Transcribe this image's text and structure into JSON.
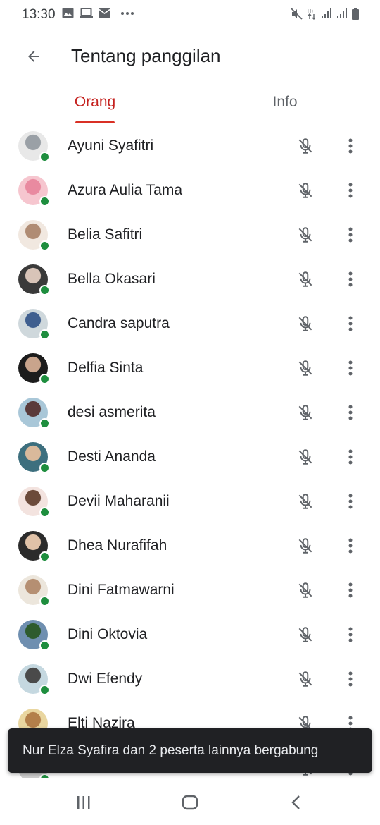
{
  "status_bar": {
    "time": "13:30",
    "left_icons": [
      "image-icon",
      "laptop-icon",
      "mail-icon",
      "more-dots-icon"
    ],
    "right_icons": [
      "mute-icon",
      "data-arrows-icon",
      "signal-icon",
      "signal-icon",
      "battery-icon"
    ],
    "network_label": "H+"
  },
  "app_bar": {
    "title": "Tentang panggilan",
    "back_icon": "arrow-back-icon"
  },
  "tabs": [
    {
      "label": "Orang",
      "selected": true
    },
    {
      "label": "Info",
      "selected": false
    }
  ],
  "participants": [
    {
      "name": "Ayuni Syafitri",
      "online": true,
      "muted": true,
      "avatar_colors": [
        "#e8e8e8",
        "#9aa0a6"
      ]
    },
    {
      "name": "Azura Aulia Tama",
      "online": true,
      "muted": true,
      "avatar_colors": [
        "#f6c6cf",
        "#e98aa0"
      ]
    },
    {
      "name": "Belia Safitri",
      "online": true,
      "muted": true,
      "avatar_colors": [
        "#f1e8e0",
        "#b08c74"
      ]
    },
    {
      "name": "Bella Okasari",
      "online": true,
      "muted": true,
      "avatar_colors": [
        "#3a3a3a",
        "#d8c4b8"
      ]
    },
    {
      "name": "Candra saputra",
      "online": true,
      "muted": true,
      "avatar_colors": [
        "#cfd8dc",
        "#3f5f8f"
      ]
    },
    {
      "name": "Delfia Sinta",
      "online": true,
      "muted": true,
      "avatar_colors": [
        "#1c1c1c",
        "#c9a48c"
      ]
    },
    {
      "name": "desi asmerita",
      "online": true,
      "muted": true,
      "avatar_colors": [
        "#a9c7d8",
        "#5a3a3a"
      ]
    },
    {
      "name": "Desti Ananda",
      "online": true,
      "muted": true,
      "avatar_colors": [
        "#3d6f7e",
        "#d9b99b"
      ]
    },
    {
      "name": "Devii Maharanii",
      "online": true,
      "muted": true,
      "avatar_colors": [
        "#f3e3df",
        "#6b4a3a"
      ]
    },
    {
      "name": "Dhea Nurafifah",
      "online": true,
      "muted": true,
      "avatar_colors": [
        "#2b2b2b",
        "#e0c2a8"
      ]
    },
    {
      "name": "Dini Fatmawarni",
      "online": true,
      "muted": true,
      "avatar_colors": [
        "#ece6dc",
        "#b58f72"
      ]
    },
    {
      "name": "Dini Oktovia",
      "online": true,
      "muted": true,
      "avatar_colors": [
        "#6f8fb0",
        "#2e5b2e"
      ]
    },
    {
      "name": "Dwi Efendy",
      "online": true,
      "muted": true,
      "avatar_colors": [
        "#c5d8e0",
        "#4a4a4a"
      ]
    },
    {
      "name": "Elti Nazira",
      "online": true,
      "muted": true,
      "avatar_colors": [
        "#e9d6a0",
        "#b37f4a"
      ]
    },
    {
      "name": "",
      "online": true,
      "muted": true,
      "avatar_colors": [
        "#cfcfcf",
        "#8a8a8a"
      ]
    }
  ],
  "snackbar": {
    "message": "Nur Elza Syafira dan 2 peserta lainnya bergabung"
  },
  "nav_bar": {
    "icons": [
      "recent-apps-icon",
      "home-icon",
      "back-nav-icon"
    ]
  },
  "colors": {
    "accent": "#d93025",
    "online": "#1e8e3e",
    "snackbar_bg": "#202124",
    "divider": "#dadce0"
  }
}
